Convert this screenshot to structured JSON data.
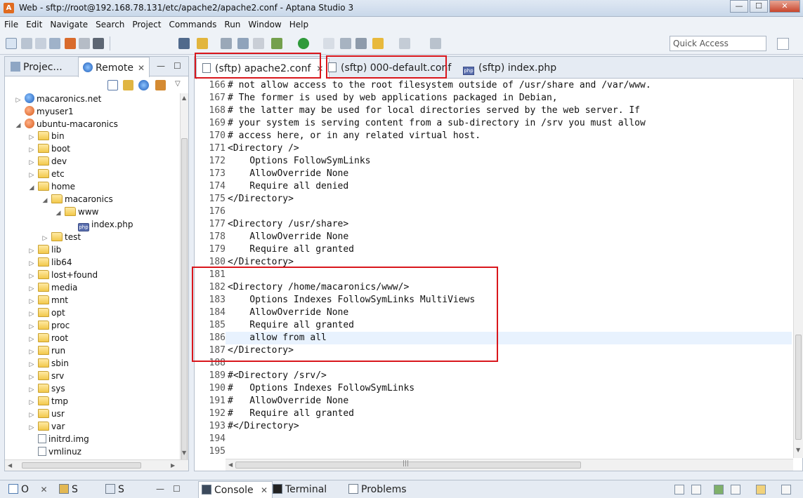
{
  "window": {
    "title": "Web - sftp://root@192.168.78.131/etc/apache2/apache2.conf - Aptana Studio 3",
    "buttons": {
      "minimize": "—",
      "maximize": "☐",
      "close": "✕"
    }
  },
  "menu": [
    "File",
    "Edit",
    "Navigate",
    "Search",
    "Project",
    "Commands",
    "Run",
    "Window",
    "Help"
  ],
  "toolbar": {
    "quick_access_placeholder": "Quick Access"
  },
  "left_panel": {
    "tabs": [
      {
        "label": "Projec...",
        "icon": "folder-tree-icon"
      },
      {
        "label": "Remote",
        "icon": "globe-icon",
        "close": "✕"
      }
    ],
    "minmax": {
      "min": "—",
      "max": "☐"
    },
    "tree": [
      {
        "label": "macaronics.net",
        "icon": "server",
        "depth": 0,
        "twisty": "▷"
      },
      {
        "label": "myuser1",
        "icon": "server-user",
        "depth": 0,
        "twisty": ""
      },
      {
        "label": "ubuntu-macaronics",
        "icon": "server-user",
        "depth": 0,
        "twisty": "◢"
      },
      {
        "label": "bin",
        "icon": "folder",
        "depth": 1,
        "twisty": "▷"
      },
      {
        "label": "boot",
        "icon": "folder",
        "depth": 1,
        "twisty": "▷"
      },
      {
        "label": "dev",
        "icon": "folder",
        "depth": 1,
        "twisty": "▷"
      },
      {
        "label": "etc",
        "icon": "folder",
        "depth": 1,
        "twisty": "▷"
      },
      {
        "label": "home",
        "icon": "folder",
        "depth": 1,
        "twisty": "◢"
      },
      {
        "label": "macaronics",
        "icon": "folder",
        "depth": 2,
        "twisty": "◢"
      },
      {
        "label": "www",
        "icon": "folder",
        "depth": 3,
        "twisty": "◢"
      },
      {
        "label": "index.php",
        "icon": "php",
        "depth": 4,
        "twisty": ""
      },
      {
        "label": "test",
        "icon": "folder",
        "depth": 2,
        "twisty": "▷"
      },
      {
        "label": "lib",
        "icon": "folder",
        "depth": 1,
        "twisty": "▷"
      },
      {
        "label": "lib64",
        "icon": "folder",
        "depth": 1,
        "twisty": "▷"
      },
      {
        "label": "lost+found",
        "icon": "folder",
        "depth": 1,
        "twisty": "▷"
      },
      {
        "label": "media",
        "icon": "folder",
        "depth": 1,
        "twisty": "▷"
      },
      {
        "label": "mnt",
        "icon": "folder",
        "depth": 1,
        "twisty": "▷"
      },
      {
        "label": "opt",
        "icon": "folder",
        "depth": 1,
        "twisty": "▷"
      },
      {
        "label": "proc",
        "icon": "folder",
        "depth": 1,
        "twisty": "▷"
      },
      {
        "label": "root",
        "icon": "folder",
        "depth": 1,
        "twisty": "▷"
      },
      {
        "label": "run",
        "icon": "folder",
        "depth": 1,
        "twisty": "▷"
      },
      {
        "label": "sbin",
        "icon": "folder",
        "depth": 1,
        "twisty": "▷"
      },
      {
        "label": "srv",
        "icon": "folder",
        "depth": 1,
        "twisty": "▷"
      },
      {
        "label": "sys",
        "icon": "folder",
        "depth": 1,
        "twisty": "▷"
      },
      {
        "label": "tmp",
        "icon": "folder",
        "depth": 1,
        "twisty": "▷"
      },
      {
        "label": "usr",
        "icon": "folder",
        "depth": 1,
        "twisty": "▷"
      },
      {
        "label": "var",
        "icon": "folder",
        "depth": 1,
        "twisty": "▷"
      },
      {
        "label": "initrd.img",
        "icon": "file",
        "depth": 1,
        "twisty": ""
      },
      {
        "label": "vmlinuz",
        "icon": "file",
        "depth": 1,
        "twisty": ""
      }
    ]
  },
  "editor": {
    "tabs": [
      {
        "label": "(sftp) apache2.conf",
        "icon": "file",
        "close": "✕",
        "active": true
      },
      {
        "label": "(sftp) 000-default.conf",
        "icon": "file",
        "close": "",
        "active": false
      },
      {
        "label": "(sftp) index.php",
        "icon": "php",
        "close": "",
        "active": false
      }
    ],
    "lines": [
      {
        "n": "166",
        "t": "# not allow access to the root filesystem outside of /usr/share and /var/www."
      },
      {
        "n": "167",
        "t": "# The former is used by web applications packaged in Debian,"
      },
      {
        "n": "168",
        "t": "# the latter may be used for local directories served by the web server. If"
      },
      {
        "n": "169",
        "t": "# your system is serving content from a sub-directory in /srv you must allow"
      },
      {
        "n": "170",
        "t": "# access here, or in any related virtual host."
      },
      {
        "n": "171",
        "t": "<Directory />"
      },
      {
        "n": "172",
        "t": "    Options FollowSymLinks"
      },
      {
        "n": "173",
        "t": "    AllowOverride None"
      },
      {
        "n": "174",
        "t": "    Require all denied"
      },
      {
        "n": "175",
        "t": "</Directory>"
      },
      {
        "n": "176",
        "t": ""
      },
      {
        "n": "177",
        "t": "<Directory /usr/share>"
      },
      {
        "n": "178",
        "t": "    AllowOverride None"
      },
      {
        "n": "179",
        "t": "    Require all granted"
      },
      {
        "n": "180",
        "t": "</Directory>"
      },
      {
        "n": "181",
        "t": ""
      },
      {
        "n": "182",
        "t": "<Directory /home/macaronics/www/>"
      },
      {
        "n": "183",
        "t": "    Options Indexes FollowSymLinks MultiViews"
      },
      {
        "n": "184",
        "t": "    AllowOverride None"
      },
      {
        "n": "185",
        "t": "    Require all granted"
      },
      {
        "n": "186",
        "t": "    allow from all"
      },
      {
        "n": "187",
        "t": "</Directory>"
      },
      {
        "n": "188",
        "t": ""
      },
      {
        "n": "189",
        "t": "#<Directory /srv/>"
      },
      {
        "n": "190",
        "t": "#   Options Indexes FollowSymLinks"
      },
      {
        "n": "191",
        "t": "#   AllowOverride None"
      },
      {
        "n": "192",
        "t": "#   Require all granted"
      },
      {
        "n": "193",
        "t": "#</Directory>"
      },
      {
        "n": "194",
        "t": ""
      },
      {
        "n": "195",
        "t": ""
      }
    ],
    "highlighted_line": "186",
    "scroll_grip": "|||"
  },
  "bottom": {
    "left_tabs": [
      {
        "label": "O",
        "icon": "outline-icon",
        "close": "✕"
      },
      {
        "label": "S",
        "icon": "snippets-icon",
        "close": ""
      },
      {
        "label": "S",
        "icon": "samples-icon",
        "close": ""
      }
    ],
    "minmax": {
      "min": "—",
      "max": "☐"
    },
    "tabs": [
      {
        "label": "Console",
        "icon": "console-icon",
        "close": "✕"
      },
      {
        "label": "Terminal",
        "icon": "terminal-icon",
        "close": ""
      },
      {
        "label": "Problems",
        "icon": "problems-icon",
        "close": ""
      }
    ]
  },
  "colors": {
    "annotation": "#d9161c",
    "highlight": "#e8f2fe"
  }
}
